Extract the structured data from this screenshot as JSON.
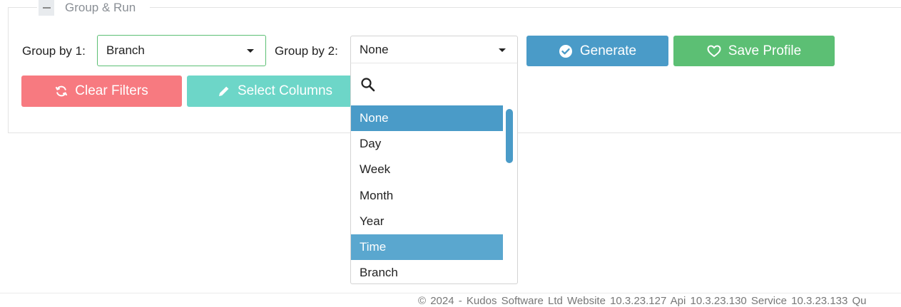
{
  "panel": {
    "title": "Group & Run"
  },
  "group_by_1": {
    "label": "Group by 1:",
    "value": "Branch"
  },
  "group_by_2": {
    "label": "Group by 2:",
    "value": "None"
  },
  "buttons": {
    "generate": "Generate",
    "save_profile": "Save Profile",
    "clear_filters": "Clear Filters",
    "select_columns": "Select Columns"
  },
  "dropdown": {
    "options": [
      "None",
      "Day",
      "Week",
      "Month",
      "Year",
      "Time",
      "Branch"
    ],
    "selected": "None",
    "highlighted": "Time"
  },
  "footer": {
    "text": "© 2024 - Kudos Software Ltd     Website 10.3.23.127   Api 10.3.23.130   Service 10.3.23.133   Qu"
  },
  "colors": {
    "generate": "#4a9bc8",
    "save_profile": "#5cbf74",
    "clear_filters": "#f77a80",
    "select_columns": "#6dd6c8",
    "dropdown_active": "#4a9bc8"
  }
}
